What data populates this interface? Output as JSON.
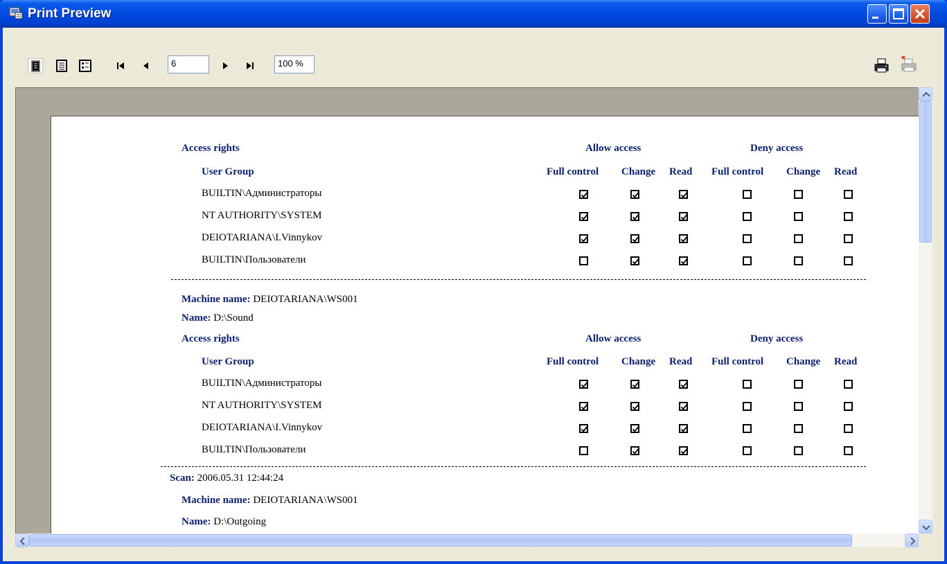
{
  "window": {
    "title": "Print Preview"
  },
  "toolbar": {
    "page_value": "6",
    "zoom_value": "100 %",
    "icons": [
      "one-page-icon",
      "two-page-icon",
      "multi-page-icon",
      "first-page-icon",
      "prev-page-icon",
      "next-page-icon",
      "last-page-icon",
      "print-icon",
      "print-setup-icon"
    ]
  },
  "report": {
    "labels": {
      "access_rights": "Access rights",
      "allow_access": "Allow access",
      "deny_access": "Deny access",
      "user_group": "User Group",
      "full_control": "Full control",
      "change": "Change",
      "read": "Read",
      "machine_name": "Machine name:",
      "name": "Name:",
      "scan": "Scan:"
    },
    "block1": {
      "rows": [
        {
          "group": "BUILTIN\\Администраторы",
          "perms": [
            true,
            true,
            true,
            false,
            false,
            false
          ]
        },
        {
          "group": "NT AUTHORITY\\SYSTEM",
          "perms": [
            true,
            true,
            true,
            false,
            false,
            false
          ]
        },
        {
          "group": "DEIOTARIANA\\I.Vinnykov",
          "perms": [
            true,
            true,
            true,
            false,
            false,
            false
          ]
        },
        {
          "group": "BUILTIN\\Пользователи",
          "perms": [
            false,
            true,
            true,
            false,
            false,
            false
          ]
        }
      ]
    },
    "block2": {
      "machine_name": "DEIOTARIANA\\WS001",
      "name": "D:\\Sound",
      "rows": [
        {
          "group": "BUILTIN\\Администраторы",
          "perms": [
            true,
            true,
            true,
            false,
            false,
            false
          ]
        },
        {
          "group": "NT AUTHORITY\\SYSTEM",
          "perms": [
            true,
            true,
            true,
            false,
            false,
            false
          ]
        },
        {
          "group": "DEIOTARIANA\\I.Vinnykov",
          "perms": [
            true,
            true,
            true,
            false,
            false,
            false
          ]
        },
        {
          "group": "BUILTIN\\Пользователи",
          "perms": [
            false,
            true,
            true,
            false,
            false,
            false
          ]
        }
      ]
    },
    "block3": {
      "scan": "2006.05.31 12:44:24",
      "machine_name": "DEIOTARIANA\\WS001",
      "name": "D:\\Outgoing"
    }
  }
}
